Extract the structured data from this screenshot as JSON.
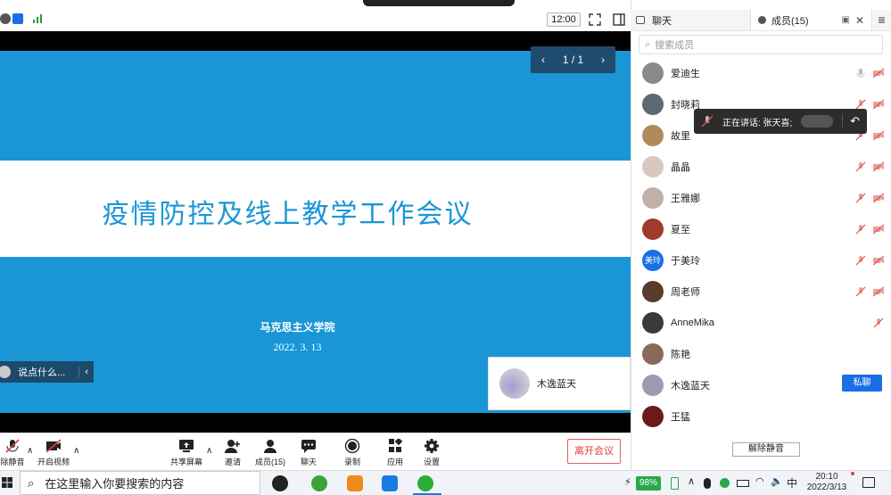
{
  "topbar": {
    "clock": "12:00"
  },
  "slide": {
    "title": "疫情防控及线上教学工作会议",
    "school": "马克思主义学院",
    "date": "2022. 3. 13",
    "pager": "1 / 1"
  },
  "chat_input": {
    "placeholder": "说点什么..."
  },
  "self_view": {
    "name": "木逸蓝天"
  },
  "toolbar": {
    "unmute": "除静音",
    "video": "开启视频",
    "share": "共享屏幕",
    "invite": "邀请",
    "members": "成员(15)",
    "chat": "聊天",
    "record": "录制",
    "apps": "应用",
    "settings": "设置",
    "leave": "离开会议"
  },
  "sidepanel": {
    "tab_chat": "聊天",
    "tab_members": "成员(15)",
    "search_placeholder": "搜索成员",
    "toast": "正在讲话: 张天喜;",
    "private_chat": "私聊",
    "unmute_all": "解除静音",
    "members": [
      {
        "name": "爱迪生",
        "avatar_color": "#8a8a8a"
      },
      {
        "name": "封晓莉",
        "avatar_color": "#5a6a70"
      },
      {
        "name": "故里",
        "avatar_color": "#b08a5a"
      },
      {
        "name": "晶晶",
        "avatar_color": "#d8c8c0"
      },
      {
        "name": "王雅娜",
        "avatar_color": "#c0b0a8"
      },
      {
        "name": "夏至",
        "avatar_color": "#a03a2a"
      },
      {
        "name": "于美玲",
        "avatar_color": "#1a6ee6",
        "avatar_text": "美玲"
      },
      {
        "name": "周老师",
        "avatar_color": "#5a3a2a"
      },
      {
        "name": "AnneMika",
        "avatar_color": "#3a3a3a"
      },
      {
        "name": "陈艳",
        "avatar_color": "#8a6a5a"
      },
      {
        "name": "木逸蓝天",
        "avatar_color": "#9a9ab0"
      },
      {
        "name": "王猛",
        "avatar_color": "#6a1a1a"
      }
    ]
  },
  "taskbar": {
    "search_placeholder": "在这里输入你要搜索的内容",
    "battery": "98%",
    "ime": "中",
    "time": "20:10",
    "date": "2022/3/13"
  }
}
